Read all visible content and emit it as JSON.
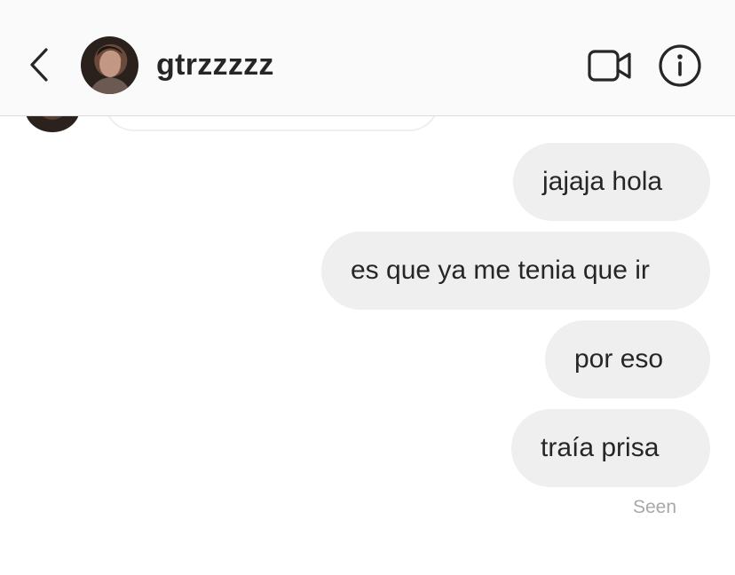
{
  "header": {
    "username": "gtrzzzzz",
    "icons": {
      "back": "chevron-left-icon",
      "video": "video-camera-icon",
      "info": "info-icon"
    }
  },
  "messages": [
    {
      "text": "jajaja hola",
      "from": "me"
    },
    {
      "text": "es que ya me tenia que ir",
      "from": "me"
    },
    {
      "text": "por eso",
      "from": "me"
    },
    {
      "text": "traía prisa",
      "from": "me"
    }
  ],
  "status": {
    "seen": "Seen"
  },
  "colors": {
    "bubble": "#efefef",
    "header_bg": "#fafafa",
    "text": "#262626",
    "muted": "#a8a8a8"
  }
}
